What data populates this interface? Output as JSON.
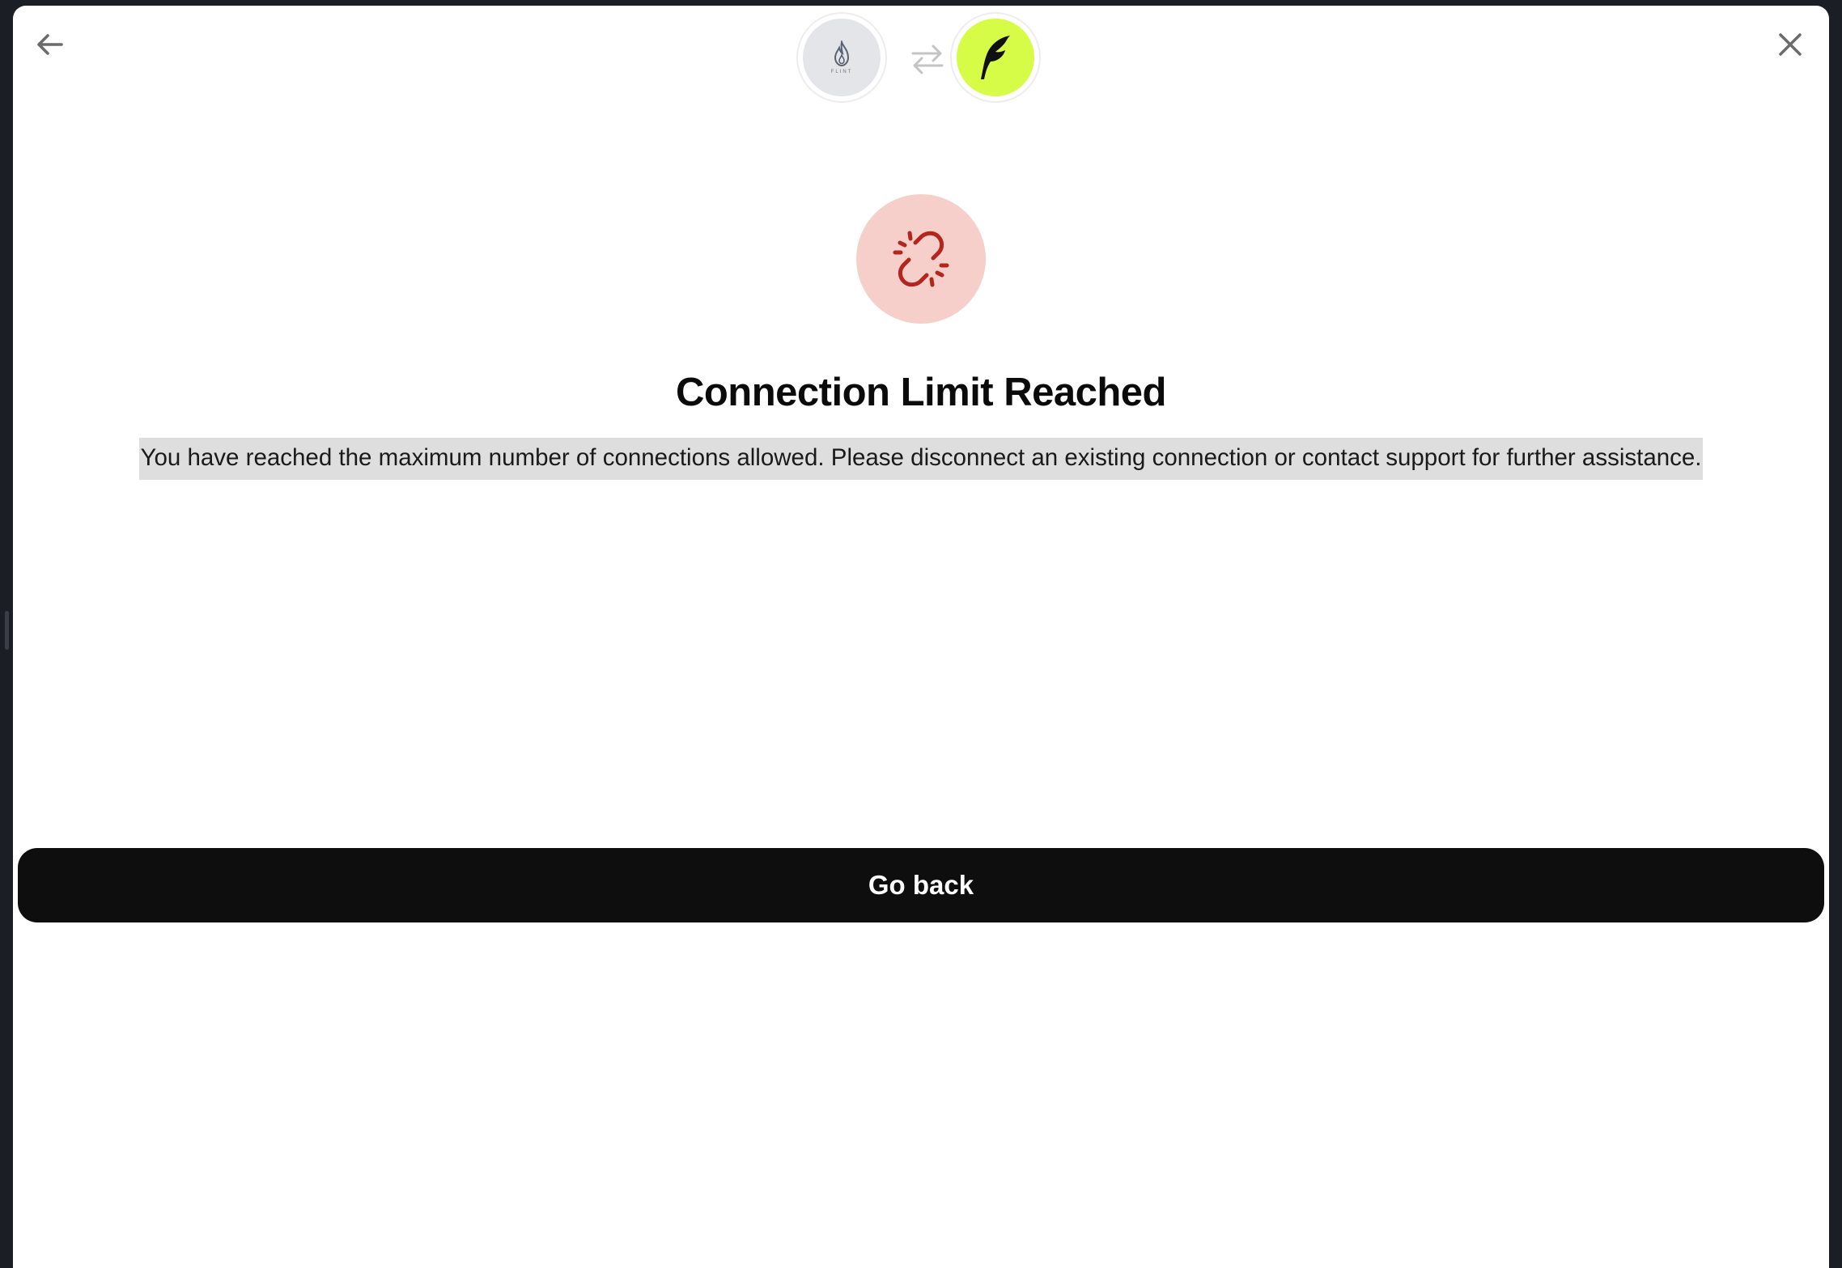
{
  "header": {
    "left_logo_text": "FLINT",
    "left_logo_icon": "flame-icon",
    "right_logo_icon": "feather-icon",
    "swap_icon": "swap-arrows-icon",
    "back_icon": "arrow-left-icon",
    "close_icon": "close-icon"
  },
  "status": {
    "icon": "broken-link-icon",
    "title": "Connection Limit Reached",
    "message": "You have reached the maximum number of connections allowed. Please disconnect an existing connection or contact support for further assistance."
  },
  "actions": {
    "go_back_label": "Go back"
  },
  "colors": {
    "status_bg": "#f6cfcb",
    "status_icon": "#b3261e",
    "right_logo_bg": "#d6fc48",
    "primary_button": "#0e0e0e",
    "message_highlight": "#dedede"
  }
}
